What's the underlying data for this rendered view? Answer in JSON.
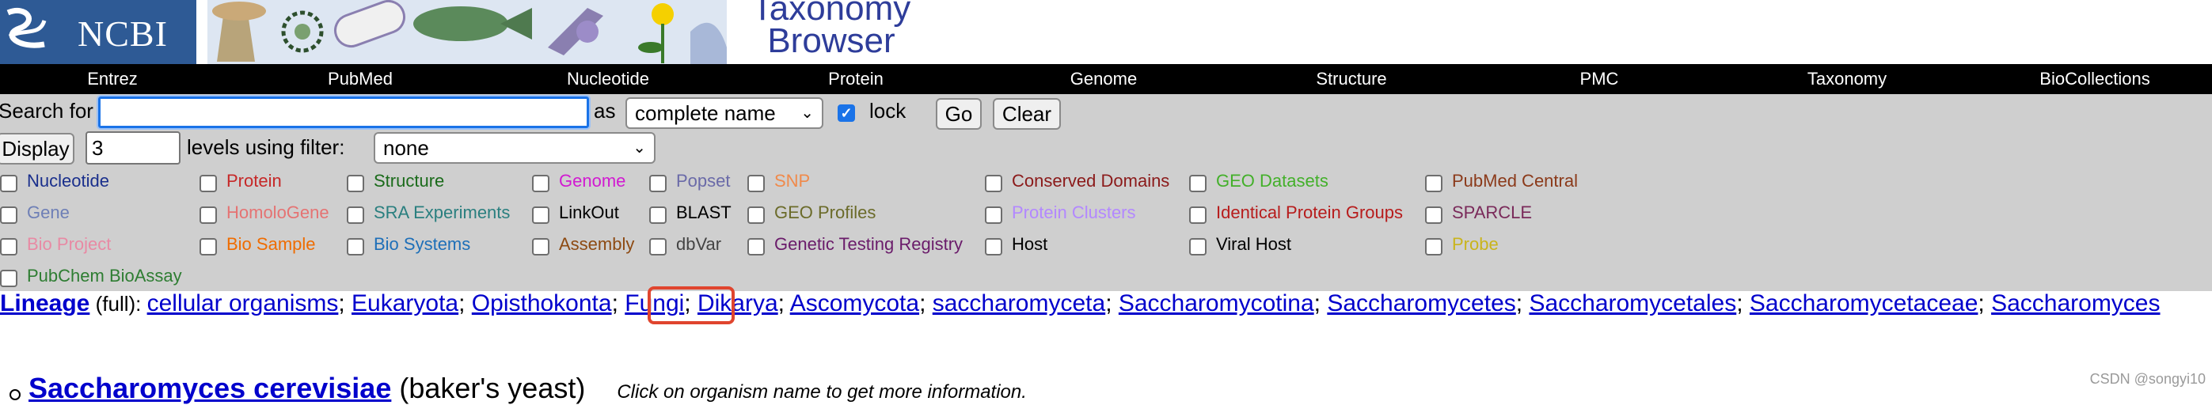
{
  "header": {
    "logo_text": "NCBI",
    "title_line1": "Taxonomy",
    "title_line2": "Browser"
  },
  "nav": [
    "Entrez",
    "PubMed",
    "Nucleotide",
    "Protein",
    "Genome",
    "Structure",
    "PMC",
    "Taxonomy",
    "BioCollections"
  ],
  "search": {
    "search_for_label": "Search for",
    "search_value": "",
    "as_label": "as",
    "name_type": "complete name",
    "lock_label": "lock",
    "lock_checked": true,
    "go_label": "Go",
    "clear_label": "Clear",
    "display_label": "Display",
    "display_value": "3",
    "levels_label": "levels using filter:",
    "filter_value": "none"
  },
  "databases": {
    "col1": [
      {
        "label": "Nucleotide",
        "color": "#1a2f8c"
      },
      {
        "label": "Gene",
        "color": "#6e7fb6"
      },
      {
        "label": "Bio Project",
        "color": "#e88aa4"
      },
      {
        "label": "PubChem BioAssay",
        "color": "#2e7d32"
      }
    ],
    "col2": [
      {
        "label": "Protein",
        "color": "#c62828"
      },
      {
        "label": "HomoloGene",
        "color": "#e57373"
      },
      {
        "label": "Bio Sample",
        "color": "#ef6c00"
      }
    ],
    "col3": [
      {
        "label": "Structure",
        "color": "#1b6b1b"
      },
      {
        "label": "SRA Experiments",
        "color": "#2a7f7f"
      },
      {
        "label": "Bio Systems",
        "color": "#1e6fb8"
      }
    ],
    "col4": [
      {
        "label": "Genome",
        "color": "#d11ad1"
      },
      {
        "label": "LinkOut",
        "color": "#000000"
      },
      {
        "label": "Assembly",
        "color": "#8d4a12"
      }
    ],
    "col5": [
      {
        "label": "Popset",
        "color": "#6a6aa8"
      },
      {
        "label": "BLAST",
        "color": "#000000"
      },
      {
        "label": "dbVar",
        "color": "#444444"
      }
    ],
    "col6": [
      {
        "label": "SNP",
        "color": "#f08a4b"
      },
      {
        "label": "GEO Profiles",
        "color": "#6b6b2a"
      },
      {
        "label": "Genetic Testing Registry",
        "color": "#6a1b6a"
      }
    ],
    "col7": [
      {
        "label": "Conserved Domains",
        "color": "#8b1a1a"
      },
      {
        "label": "Protein Clusters",
        "color": "#b388ff"
      },
      {
        "label": "Host",
        "color": "#000000"
      }
    ],
    "col8": [
      {
        "label": "GEO Datasets",
        "color": "#43b02a"
      },
      {
        "label": "Identical Protein Groups",
        "color": "#b71c1c"
      },
      {
        "label": "Viral Host",
        "color": "#000000"
      }
    ],
    "col9": [
      {
        "label": "PubMed Central",
        "color": "#8b3a1a"
      },
      {
        "label": "SPARCLE",
        "color": "#7a2a5a"
      },
      {
        "label": "Probe",
        "color": "#c9b41c"
      }
    ]
  },
  "lineage": {
    "label": "Lineage",
    "full": "(full)",
    "items": [
      "cellular organisms",
      "Eukaryota",
      "Opisthokonta",
      "Fungi",
      "Dikarya",
      "Ascomycota",
      "saccharomyceta",
      "Saccharomycotina",
      "Saccharomycetes",
      "Saccharomycetales",
      "Saccharomycetaceae",
      "Saccharomyces"
    ]
  },
  "species": {
    "name": "Saccharomyces cerevisiae",
    "common": "(baker's yeast)",
    "hint": "Click on organism name to get more information."
  },
  "watermark": "CSDN @songyi10"
}
